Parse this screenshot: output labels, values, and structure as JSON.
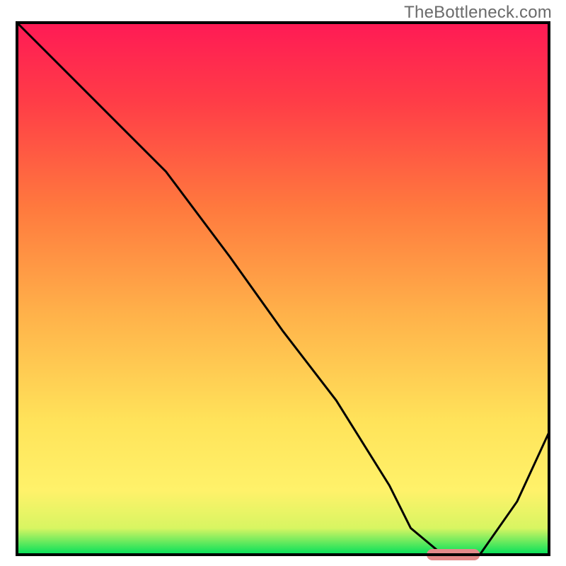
{
  "watermark_text": "TheBottleneck.com",
  "chart_data": {
    "type": "line",
    "title": "",
    "xlabel": "",
    "ylabel": "",
    "x_range": [
      0,
      100
    ],
    "y_range": [
      0,
      100
    ],
    "gradient_colors": [
      {
        "offset": 0.0,
        "color": "#00e05a"
      },
      {
        "offset": 0.05,
        "color": "#d8f562"
      },
      {
        "offset": 0.12,
        "color": "#fff26a"
      },
      {
        "offset": 0.25,
        "color": "#ffe35a"
      },
      {
        "offset": 0.45,
        "color": "#ffb24a"
      },
      {
        "offset": 0.65,
        "color": "#ff7a3e"
      },
      {
        "offset": 0.85,
        "color": "#ff3d47"
      },
      {
        "offset": 1.0,
        "color": "#ff1a55"
      }
    ],
    "series": [
      {
        "name": "bottleneck-curve",
        "x": [
          0,
          10,
          20,
          28,
          40,
          50,
          60,
          70,
          74,
          80,
          87,
          94,
          100
        ],
        "y": [
          100,
          90,
          80,
          72,
          56,
          42,
          29,
          13,
          5,
          0,
          0,
          10,
          23
        ]
      }
    ],
    "marker": {
      "name": "optimal-range-marker",
      "x_start": 77,
      "x_end": 87,
      "y": 0,
      "color": "#e48a8a"
    },
    "frame_color": "#000000",
    "curve_color": "#000000"
  }
}
